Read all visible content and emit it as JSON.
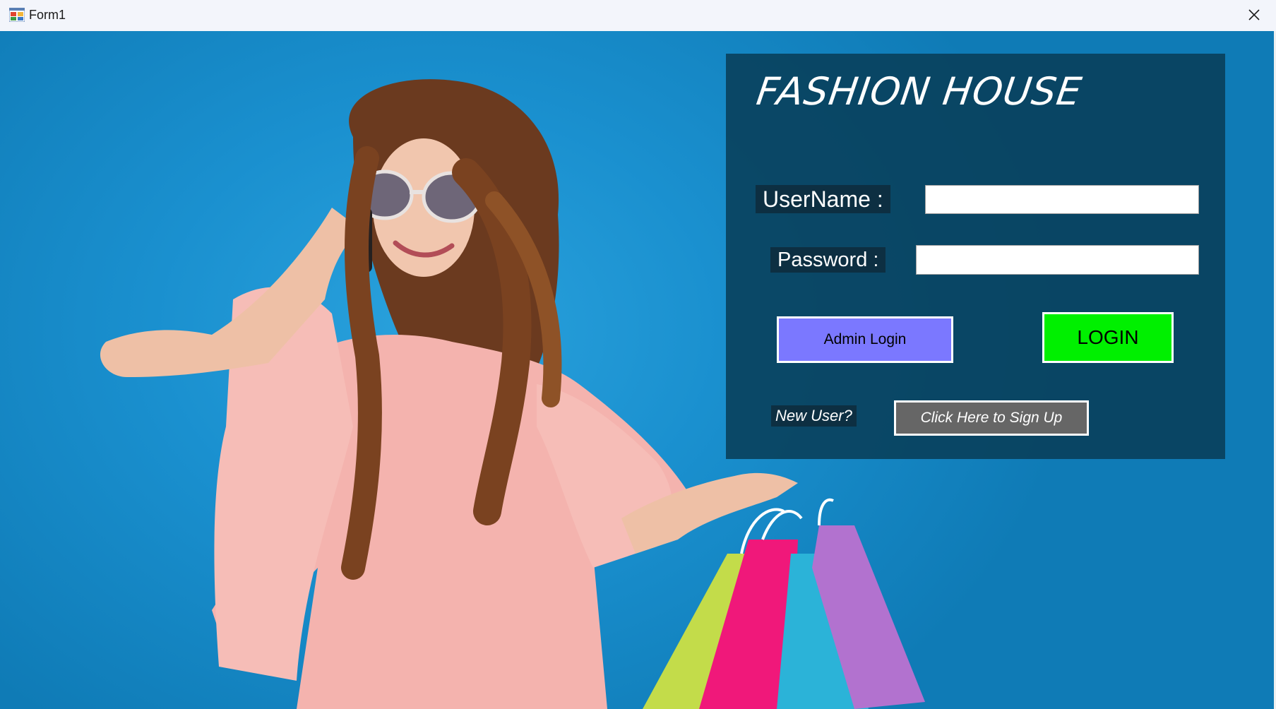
{
  "window": {
    "title": "Form1",
    "app_icon": "windows-form-icon",
    "close_icon": "close-icon"
  },
  "panel": {
    "brand": "FASHION HOUSE",
    "username_label": "UserName :",
    "username_value": "",
    "password_label": "Password :",
    "password_value": "",
    "admin_login_label": "Admin Login",
    "login_label": "LOGIN",
    "new_user_label": "New User?",
    "signup_label": "Click Here to Sign Up"
  },
  "colors": {
    "background_blue": "#1a90cf",
    "panel": "#083c56",
    "admin_button": "#7b78ff",
    "login_button": "#00f000",
    "signup_button": "#666666"
  }
}
